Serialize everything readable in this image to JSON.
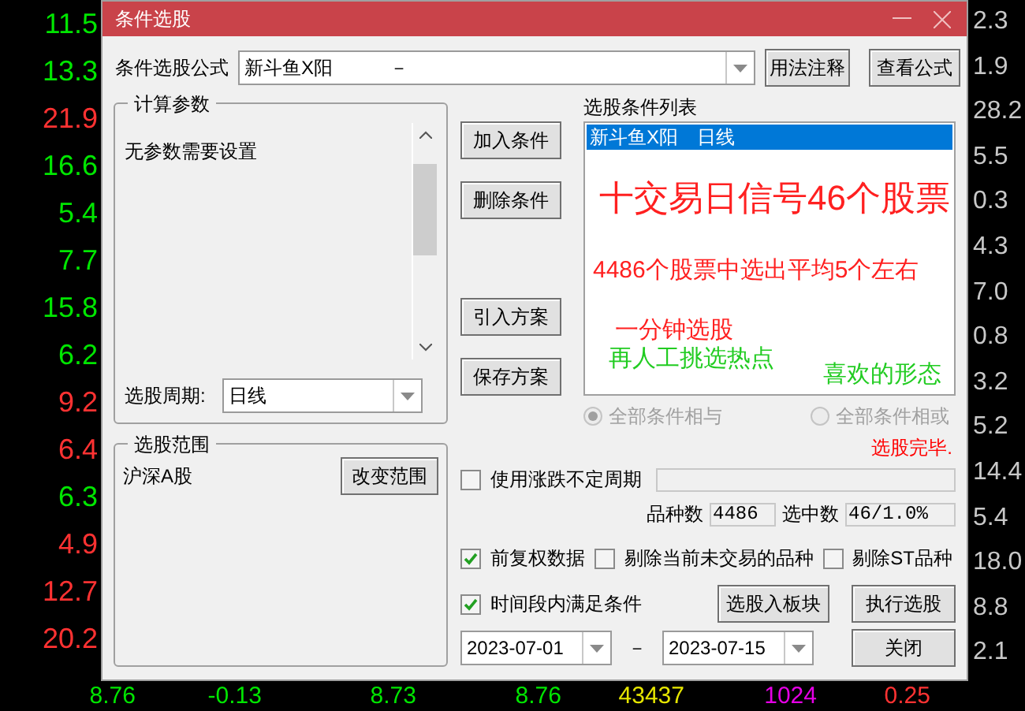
{
  "background": {
    "left_column": [
      {
        "text": "11.5",
        "color": "#00e600"
      },
      {
        "text": "13.3",
        "color": "#00e600"
      },
      {
        "text": "21.9",
        "color": "#ff3232"
      },
      {
        "text": "16.6",
        "color": "#00e600"
      },
      {
        "text": "5.4",
        "color": "#00e600"
      },
      {
        "text": "7.7",
        "color": "#00e600"
      },
      {
        "text": "15.8",
        "color": "#00e600"
      },
      {
        "text": "6.2",
        "color": "#00e600"
      },
      {
        "text": "9.2",
        "color": "#ff3232"
      },
      {
        "text": "6.4",
        "color": "#ff3232"
      },
      {
        "text": "6.3",
        "color": "#00e600"
      },
      {
        "text": "4.9",
        "color": "#ff3232"
      },
      {
        "text": "12.7",
        "color": "#ff3232"
      },
      {
        "text": "20.2",
        "color": "#ff3232"
      }
    ],
    "right_column": [
      "2.3",
      "1.9",
      "28.2",
      "5.5",
      "0.3",
      "4.3",
      "7.0",
      "0.8",
      "3.2",
      "5.2",
      "14.4",
      "5.4",
      "18.0",
      "8.8",
      "2.1"
    ],
    "bottom_row": [
      {
        "text": "8.76",
        "color": "#00e600"
      },
      {
        "text": "-0.13",
        "color": "#00e600"
      },
      {
        "text": "8.73",
        "color": "#00e600"
      },
      {
        "text": "8.76",
        "color": "#00e600"
      },
      {
        "text": "43437",
        "color": "#e6e600"
      },
      {
        "text": "1024",
        "color": "#e600e6"
      },
      {
        "text": "0.25",
        "color": "#ff3232"
      }
    ]
  },
  "dialog": {
    "title": "条件选股",
    "formula": {
      "label": "条件选股公式",
      "value": "新斗鱼X阳　　　－"
    },
    "top_buttons": [
      "用法注释",
      "查看公式"
    ],
    "params": {
      "title": "计算参数",
      "text": "无参数需要设置",
      "period_label": "选股周期:",
      "period_value": "日线"
    },
    "scope": {
      "title": "选股范围",
      "value": "沪深A股",
      "button": "改变范围"
    },
    "side_buttons": [
      "加入条件",
      "删除条件",
      "引入方案",
      "保存方案"
    ],
    "list": {
      "title": "选股条件列表",
      "items": [
        {
          "text": "新斗鱼X阳　日线",
          "selected": true
        }
      ],
      "overlays": [
        {
          "text": "十交易日信号46个股票",
          "color": "#ff2020",
          "kind": "large"
        },
        {
          "text": "4486个股票中选出平均5个左右",
          "color": "#ff2020",
          "kind": "medium"
        },
        {
          "text": "一分钟选股",
          "color": "#ff2020",
          "kind": "medium"
        },
        {
          "text": "再人工挑选热点",
          "color": "#22cc22",
          "kind": "medium"
        },
        {
          "text": "喜欢的形态",
          "color": "#22cc22",
          "kind": "medium"
        }
      ]
    },
    "radios": [
      {
        "label": "全部条件相与",
        "selected": true,
        "disabled": true
      },
      {
        "label": "全部条件相或",
        "selected": false,
        "disabled": true
      }
    ],
    "status": "选股完毕.",
    "period_option": {
      "label": "使用涨跌不定周期",
      "checked": false
    },
    "progress": {
      "level": 0
    },
    "counts": [
      {
        "label": "品种数",
        "value": "4486"
      },
      {
        "label": "选中数",
        "value": "46/1.0%"
      }
    ],
    "options": [
      {
        "label": "前复权数据",
        "checked": true
      },
      {
        "label": "剔除当前未交易的品种",
        "checked": false
      },
      {
        "label": "剔除ST品种",
        "checked": false
      }
    ],
    "range_option": {
      "label": "时间段内满足条件",
      "checked": true
    },
    "action_buttons": [
      "选股入板块",
      "执行选股",
      "关闭"
    ],
    "dates": [
      "2023-07-01",
      "2023-07-15"
    ],
    "date_separator": "－"
  }
}
